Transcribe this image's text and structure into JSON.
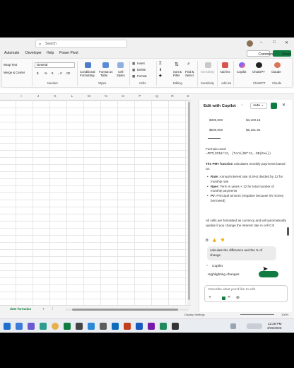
{
  "window": {
    "search_placeholder": "Search",
    "controls": [
      "–",
      "□",
      "✕"
    ]
  },
  "menu": {
    "tabs": [
      "Automate",
      "Developer",
      "Help",
      "Power Pivot"
    ],
    "comments": "Comments",
    "share": "Share"
  },
  "ribbon": {
    "wrap_text": "Wrap Text",
    "merge_center": "Merge & Center",
    "number_format": "General",
    "number_symbols": [
      "$",
      "%",
      "9",
      "←0",
      ".00"
    ],
    "conditional_formatting": [
      "Conditional",
      "Formatting"
    ],
    "format_as_table": [
      "Format as",
      "Table"
    ],
    "cell_styles": [
      "Cell",
      "Styles"
    ],
    "insert": "Insert",
    "delete": "Delete",
    "format": "Format",
    "sort_filter": [
      "Sort &",
      "Filter"
    ],
    "find_select": [
      "Find &",
      "Select"
    ],
    "sensitivity": "Sensitivity",
    "addins": "Add-ins",
    "copilot": "Copilot",
    "chatgpt": "ChatGPT",
    "claude": "Claude",
    "groups": [
      "Number",
      "Styles",
      "Cells",
      "Editing",
      "Sensitivity",
      "Add-ins",
      "ChatGPT",
      "Claude"
    ]
  },
  "sheet": {
    "columns": [
      "I",
      "J",
      "K",
      "L",
      "M",
      "N",
      "O",
      "P",
      "Q",
      "R",
      "S"
    ],
    "tab_label": "date formulas"
  },
  "status": {
    "display_settings": "Display Settings",
    "zoom": "100%"
  },
  "taskbar": {
    "time": "12:26 PM",
    "date": "3/25/2026"
  },
  "copilot": {
    "title": "Edit with Copilot",
    "mode": "Auto",
    "rows": [
      {
        "left": "$300,000",
        "right": "$3,109.15"
      },
      {
        "left": "$500,000",
        "right": "$5,181.92"
      }
    ],
    "formula_label": "Formula used:",
    "formula": "=PMT($C$4/12, {Term}$9*12,-$B{Row})",
    "intro_bold": "The PMT function",
    "intro_rest": " calculates monthly payments based on:",
    "bullets": [
      {
        "key": "Rate:",
        "text": " Annual interest rate (4.5%) divided by 12 for monthly rate"
      },
      {
        "key": "Nper:",
        "text": " Term in years × 12 for total number of monthly payments"
      },
      {
        "key": "Pv:",
        "text": " Principal amount (negative because it's money borrowed)"
      }
    ],
    "note": "All cells are formatted as currency and will automatically update if you change the interest rate in cell C4!",
    "user_message": "calculate the difference and the % of change",
    "reply_label": "Copilot",
    "status": "Highlighting changes",
    "input_placeholder": "Describe what you'd like to edit"
  },
  "colors": {
    "excel_green": "#107c41",
    "accent_blue": "#2b6cd4"
  }
}
